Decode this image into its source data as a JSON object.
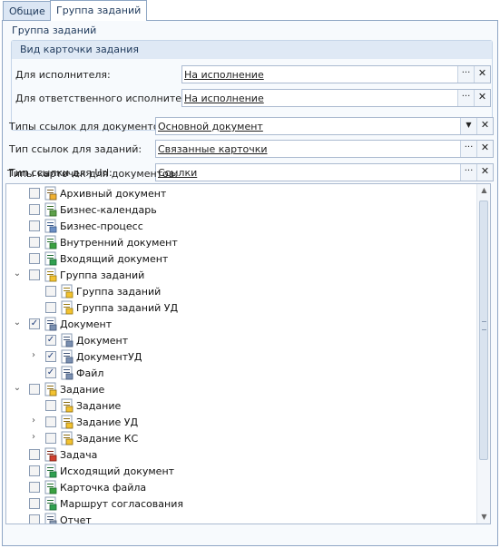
{
  "tabs": [
    {
      "label": "Общие",
      "active": false
    },
    {
      "label": "Группа заданий",
      "active": true
    }
  ],
  "group": {
    "title": "Группа заданий",
    "card_view": {
      "title": "Вид карточки задания",
      "executor_label": "Для исполнителя:",
      "executor_value": "На исполнение",
      "responsible_label": "Для ответственного исполнителя:",
      "responsible_value": "На исполнение"
    }
  },
  "doc_link_types": {
    "label": "Типы ссылок для документов:",
    "value": "Основной документ"
  },
  "task_link_type": {
    "label": "Тип ссылок для заданий:",
    "value": "Связанные карточки"
  },
  "url_link_type": {
    "label": "Тип ссылки для Url:",
    "value": "Ссылки"
  },
  "buttons": {
    "ellipsis": "···",
    "clear": "✕",
    "dropdown": "▼"
  },
  "tree": {
    "label": "Типы карточек для документов:",
    "items": [
      {
        "text": "Архивный документ",
        "level": 0,
        "checked": false,
        "expander": "",
        "icon": "archive-document-icon"
      },
      {
        "text": "Бизнес-календарь",
        "level": 0,
        "checked": false,
        "expander": "",
        "icon": "business-calendar-icon"
      },
      {
        "text": "Бизнес-процесс",
        "level": 0,
        "checked": false,
        "expander": "",
        "icon": "business-process-icon"
      },
      {
        "text": "Внутренний документ",
        "level": 0,
        "checked": false,
        "expander": "",
        "icon": "internal-document-icon"
      },
      {
        "text": "Входящий документ",
        "level": 0,
        "checked": false,
        "expander": "",
        "icon": "incoming-document-icon"
      },
      {
        "text": "Группа заданий",
        "level": 0,
        "checked": false,
        "expander": "⌄",
        "icon": "task-group-icon"
      },
      {
        "text": "Группа заданий",
        "level": 1,
        "checked": false,
        "expander": "",
        "icon": "task-group-icon"
      },
      {
        "text": "Группа заданий УД",
        "level": 1,
        "checked": false,
        "expander": "",
        "icon": "task-group-icon"
      },
      {
        "text": "Документ",
        "level": 0,
        "checked": true,
        "expander": "⌄",
        "icon": "document-icon"
      },
      {
        "text": "Документ",
        "level": 1,
        "checked": true,
        "expander": "",
        "icon": "document-icon"
      },
      {
        "text": "ДокументУД",
        "level": 1,
        "checked": true,
        "expander": "›",
        "icon": "document-icon"
      },
      {
        "text": "Файл",
        "level": 1,
        "checked": true,
        "expander": "",
        "icon": "file-icon"
      },
      {
        "text": "Задание",
        "level": 0,
        "checked": false,
        "expander": "⌄",
        "icon": "task-icon"
      },
      {
        "text": "Задание",
        "level": 1,
        "checked": false,
        "expander": "",
        "icon": "task-icon"
      },
      {
        "text": "Задание УД",
        "level": 1,
        "checked": false,
        "expander": "›",
        "icon": "task-icon"
      },
      {
        "text": "Задание КС",
        "level": 1,
        "checked": false,
        "expander": "›",
        "icon": "task-icon"
      },
      {
        "text": "Задача",
        "level": 0,
        "checked": false,
        "expander": "",
        "icon": "assignment-icon"
      },
      {
        "text": "Исходящий документ",
        "level": 0,
        "checked": false,
        "expander": "",
        "icon": "outgoing-document-icon"
      },
      {
        "text": "Карточка файла",
        "level": 0,
        "checked": false,
        "expander": "",
        "icon": "file-card-icon"
      },
      {
        "text": "Маршрут согласования",
        "level": 0,
        "checked": false,
        "expander": "",
        "icon": "approval-route-icon"
      },
      {
        "text": "Отчет",
        "level": 0,
        "checked": false,
        "expander": "",
        "icon": "report-icon"
      }
    ]
  },
  "scrollbar": {
    "up": "▲",
    "down": "▼"
  }
}
